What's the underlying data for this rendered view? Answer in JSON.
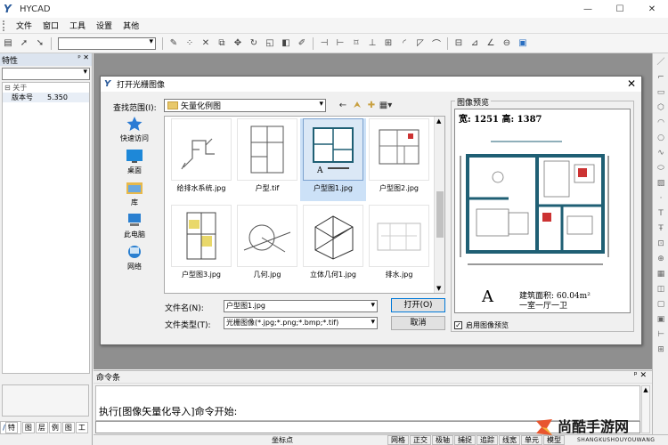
{
  "app": {
    "title": "HYCAD",
    "window_controls": [
      "—",
      "☐",
      "✕"
    ]
  },
  "menu": [
    "文件",
    "窗口",
    "工具",
    "设置",
    "其他"
  ],
  "properties_panel": {
    "title": "特性",
    "pins": "ᵖ ✕",
    "category": "关于",
    "rows": [
      {
        "key": "版本号",
        "value": "5.350"
      }
    ],
    "tabs": [
      "特",
      "图",
      "层",
      "例",
      "图",
      "工"
    ]
  },
  "dialog": {
    "title": "打开光栅图像",
    "lookin_label": "查找范围(I):",
    "lookin_value": "矢量化例图",
    "places": [
      {
        "label": "快速访问",
        "icon": "star-icon"
      },
      {
        "label": "桌面",
        "icon": "desktop-icon"
      },
      {
        "label": "库",
        "icon": "library-icon"
      },
      {
        "label": "此电脑",
        "icon": "computer-icon"
      },
      {
        "label": "网络",
        "icon": "network-icon"
      }
    ],
    "files": [
      {
        "name": "给排水系统.jpg",
        "selected": false
      },
      {
        "name": "户型.tif",
        "selected": false
      },
      {
        "name": "户型图1.jpg",
        "selected": true
      },
      {
        "name": "户型图2.jpg",
        "selected": false
      },
      {
        "name": "户型图3.jpg",
        "selected": false
      },
      {
        "name": "几何.jpg",
        "selected": false
      },
      {
        "name": "立体几何1.jpg",
        "selected": false
      },
      {
        "name": "排水.jpg",
        "selected": false
      }
    ],
    "filename_label": "文件名(N):",
    "filename_value": "户型图1.jpg",
    "filetype_label": "文件类型(T):",
    "filetype_value": "光栅图像(*.jpg;*.png;*.bmp;*.tif)",
    "open_button": "打开(O)",
    "cancel_button": "取消",
    "preview_group_label": "图像预览",
    "preview_dims": "宽: 1251 高: 1387",
    "preview_big_letter": "A",
    "preview_area": "建筑面积: 60.04m²",
    "preview_type": "一室一厅一卫",
    "enable_preview_label": "启用图像预览",
    "enable_preview_checked": true
  },
  "command_panel": {
    "title": "命令条",
    "output": "执行[图像矢量化导入]命令开始:"
  },
  "statusbar": {
    "coord_label": "坐标点",
    "toggles": [
      "网格",
      "正交",
      "极轴",
      "捕捉",
      "追踪",
      "线宽",
      "单元",
      "模型"
    ]
  },
  "watermark": {
    "text": "尚酷手游网",
    "sub": "SHANGKUSHOUYOUWANG"
  },
  "colors": {
    "accent": "#0078d7",
    "canvas": "#8f8f8f",
    "selection": "#cce1f7",
    "floorplan_wall": "#1f5f74"
  }
}
